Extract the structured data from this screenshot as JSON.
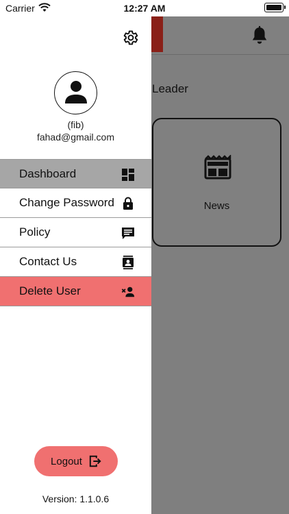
{
  "status_bar": {
    "carrier": "Carrier",
    "time": "12:27 AM"
  },
  "main": {
    "leader_label": "Leader",
    "news_card_label": "News"
  },
  "drawer": {
    "user_name": "(fib)",
    "user_email": "fahad@gmail.com",
    "menu_items": [
      {
        "label": "Dashboard",
        "icon": "dashboard-icon"
      },
      {
        "label": "Change Password",
        "icon": "lock-icon"
      },
      {
        "label": "Policy",
        "icon": "policy-icon"
      },
      {
        "label": "Contact Us",
        "icon": "contact-icon"
      },
      {
        "label": "Delete User",
        "icon": "delete-user-icon"
      }
    ],
    "logout_label": "Logout",
    "version": "Version: 1.1.0.6"
  },
  "colors": {
    "accent": "#f07070",
    "active_item": "#a6a6a6",
    "overlay": "#7f7f7f",
    "header_tab": "#8a2018"
  }
}
